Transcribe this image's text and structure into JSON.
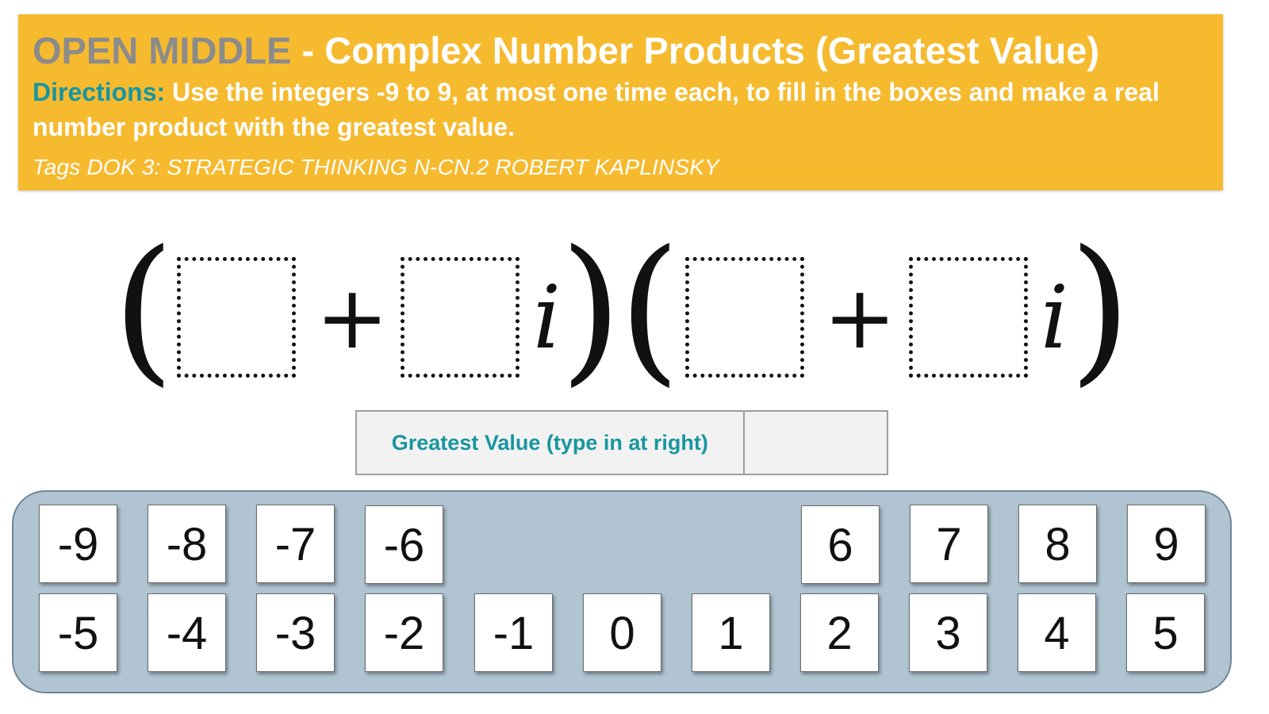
{
  "header": {
    "brand": "OPEN MIDDLE",
    "title_rest": " - Complex Number Products (Greatest Value)",
    "directions_label": "Directions:",
    "directions_text": " Use the integers -9 to 9, at most one time each, to fill in the boxes and make a real number product with the greatest value.",
    "tags": "Tags DOK 3: STRATEGIC THINKING N-CN.2 ROBERT KAPLINSKY"
  },
  "expression": {
    "open_paren": "(",
    "close_paren": ")",
    "plus": "+",
    "imaginary_unit": "i"
  },
  "answer": {
    "label": "Greatest Value (type in at right)",
    "value": "",
    "placeholder": ""
  },
  "tiles": {
    "top_row": [
      "-9",
      "-8",
      "-7",
      "-6",
      "6",
      "7",
      "8",
      "9"
    ],
    "bottom_row": [
      "-5",
      "-4",
      "-3",
      "-2",
      "-1",
      "0",
      "1",
      "2",
      "3",
      "4",
      "5"
    ]
  }
}
